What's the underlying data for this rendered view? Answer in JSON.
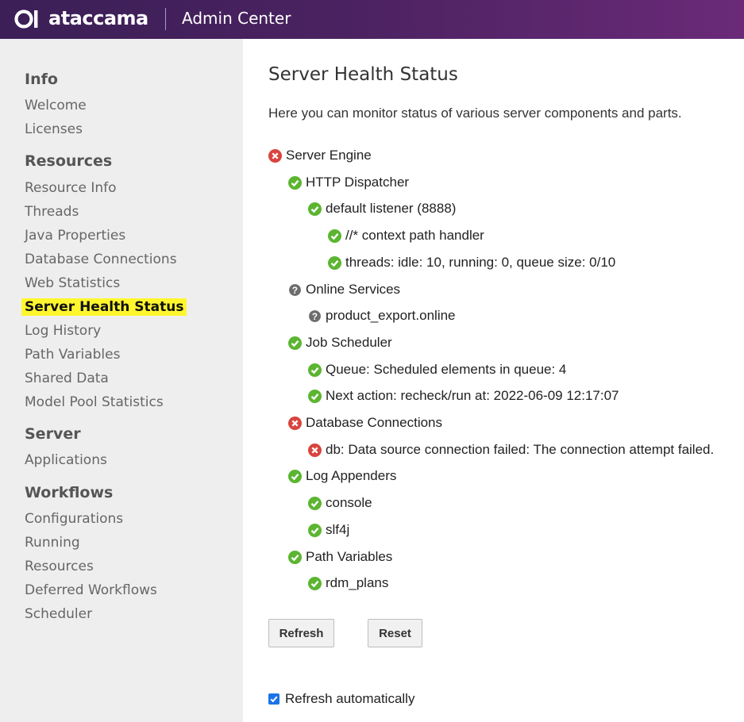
{
  "header": {
    "brand": "ataccama",
    "app_title": "Admin Center",
    "colors": {
      "gradient_start": "#3b1f56",
      "gradient_end": "#6a2a78"
    }
  },
  "sidebar": {
    "groups": [
      {
        "title": "Info",
        "items": [
          "Welcome",
          "Licenses"
        ]
      },
      {
        "title": "Resources",
        "items": [
          "Resource Info",
          "Threads",
          "Java Properties",
          "Database Connections",
          "Web Statistics",
          "Server Health Status",
          "Log History",
          "Path Variables",
          "Shared Data",
          "Model Pool Statistics"
        ]
      },
      {
        "title": "Server",
        "items": [
          "Applications"
        ]
      },
      {
        "title": "Workflows",
        "items": [
          "Configurations",
          "Running",
          "Resources",
          "Deferred Workflows",
          "Scheduler"
        ]
      }
    ],
    "active_item": "Server Health Status",
    "highlight_color": "#fff62e"
  },
  "main": {
    "title": "Server Health Status",
    "intro": "Here you can monitor status of various server components and parts.",
    "status_colors": {
      "ok": "#5cb531",
      "error": "#d9443f",
      "unknown": "#6d6d6d"
    },
    "tree": [
      {
        "label": "Server Engine",
        "status": "error",
        "level": 0
      },
      {
        "label": "HTTP Dispatcher",
        "status": "ok",
        "level": 1
      },
      {
        "label": "default listener (8888)",
        "status": "ok",
        "level": 2
      },
      {
        "label": "//* context path handler",
        "status": "ok",
        "level": 3
      },
      {
        "label": "threads: idle: 10, running: 0, queue size: 0/10",
        "status": "ok",
        "level": 3
      },
      {
        "label": "Online Services",
        "status": "unknown",
        "level": 1
      },
      {
        "label": "product_export.online",
        "status": "unknown",
        "level": 2
      },
      {
        "label": "Job Scheduler",
        "status": "ok",
        "level": 1
      },
      {
        "label": "Queue: Scheduled elements in queue: 4",
        "status": "ok",
        "level": 2
      },
      {
        "label": "Next action: recheck/run at: 2022-06-09 12:17:07",
        "status": "ok",
        "level": 2
      },
      {
        "label": "Database Connections",
        "status": "error",
        "level": 1
      },
      {
        "label": "db: Data source connection failed: The connection attempt failed.",
        "status": "error",
        "level": 2
      },
      {
        "label": "Log Appenders",
        "status": "ok",
        "level": 1
      },
      {
        "label": "console",
        "status": "ok",
        "level": 2
      },
      {
        "label": "slf4j",
        "status": "ok",
        "level": 2
      },
      {
        "label": "Path Variables",
        "status": "ok",
        "level": 1
      },
      {
        "label": "rdm_plans",
        "status": "ok",
        "level": 2
      }
    ],
    "buttons": {
      "refresh": "Refresh",
      "reset": "Reset"
    },
    "auto_refresh": {
      "label": "Refresh automatically",
      "checked": true
    }
  }
}
